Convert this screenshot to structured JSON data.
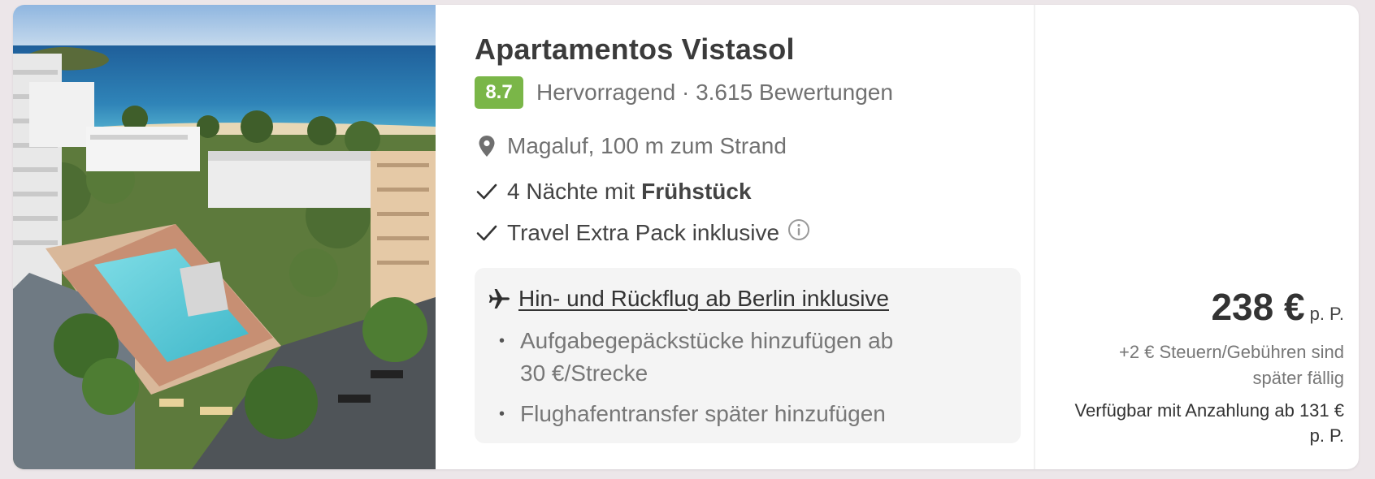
{
  "hotel": {
    "name": "Apartamentos Vistasol",
    "rating_score": "8.7",
    "rating_text": "Hervorragend · 3.615 Bewertungen",
    "photo_alt": "hotel-photo"
  },
  "features": {
    "location": "Magaluf, 100 m zum Strand",
    "nights": "4 Nächte mit",
    "board": "Frühstück",
    "extra_pack": "Travel Extra Pack inklusive"
  },
  "flight": {
    "title": "Hin- und Rückflug ab Berlin inklusive",
    "bullets": [
      "Aufgabegepäckstücke hinzufügen ab 30 €/Strecke",
      "Flughafentransfer später hinzufügen"
    ]
  },
  "price": {
    "amount": "238 €",
    "unit": "p. P.",
    "tax_note": "+2 € Steuern/Gebühren sind später fällig",
    "deposit_note": "Verfügbar mit Anzahlung ab 131 € p. P."
  },
  "icons": {
    "location": "map-pin-icon",
    "check": "check-icon",
    "info": "info-icon",
    "plane": "plane-icon"
  },
  "colors": {
    "rating_badge": "#7ab648",
    "flight_box_bg": "#f4f4f4",
    "page_bg": "#ece6e9"
  }
}
